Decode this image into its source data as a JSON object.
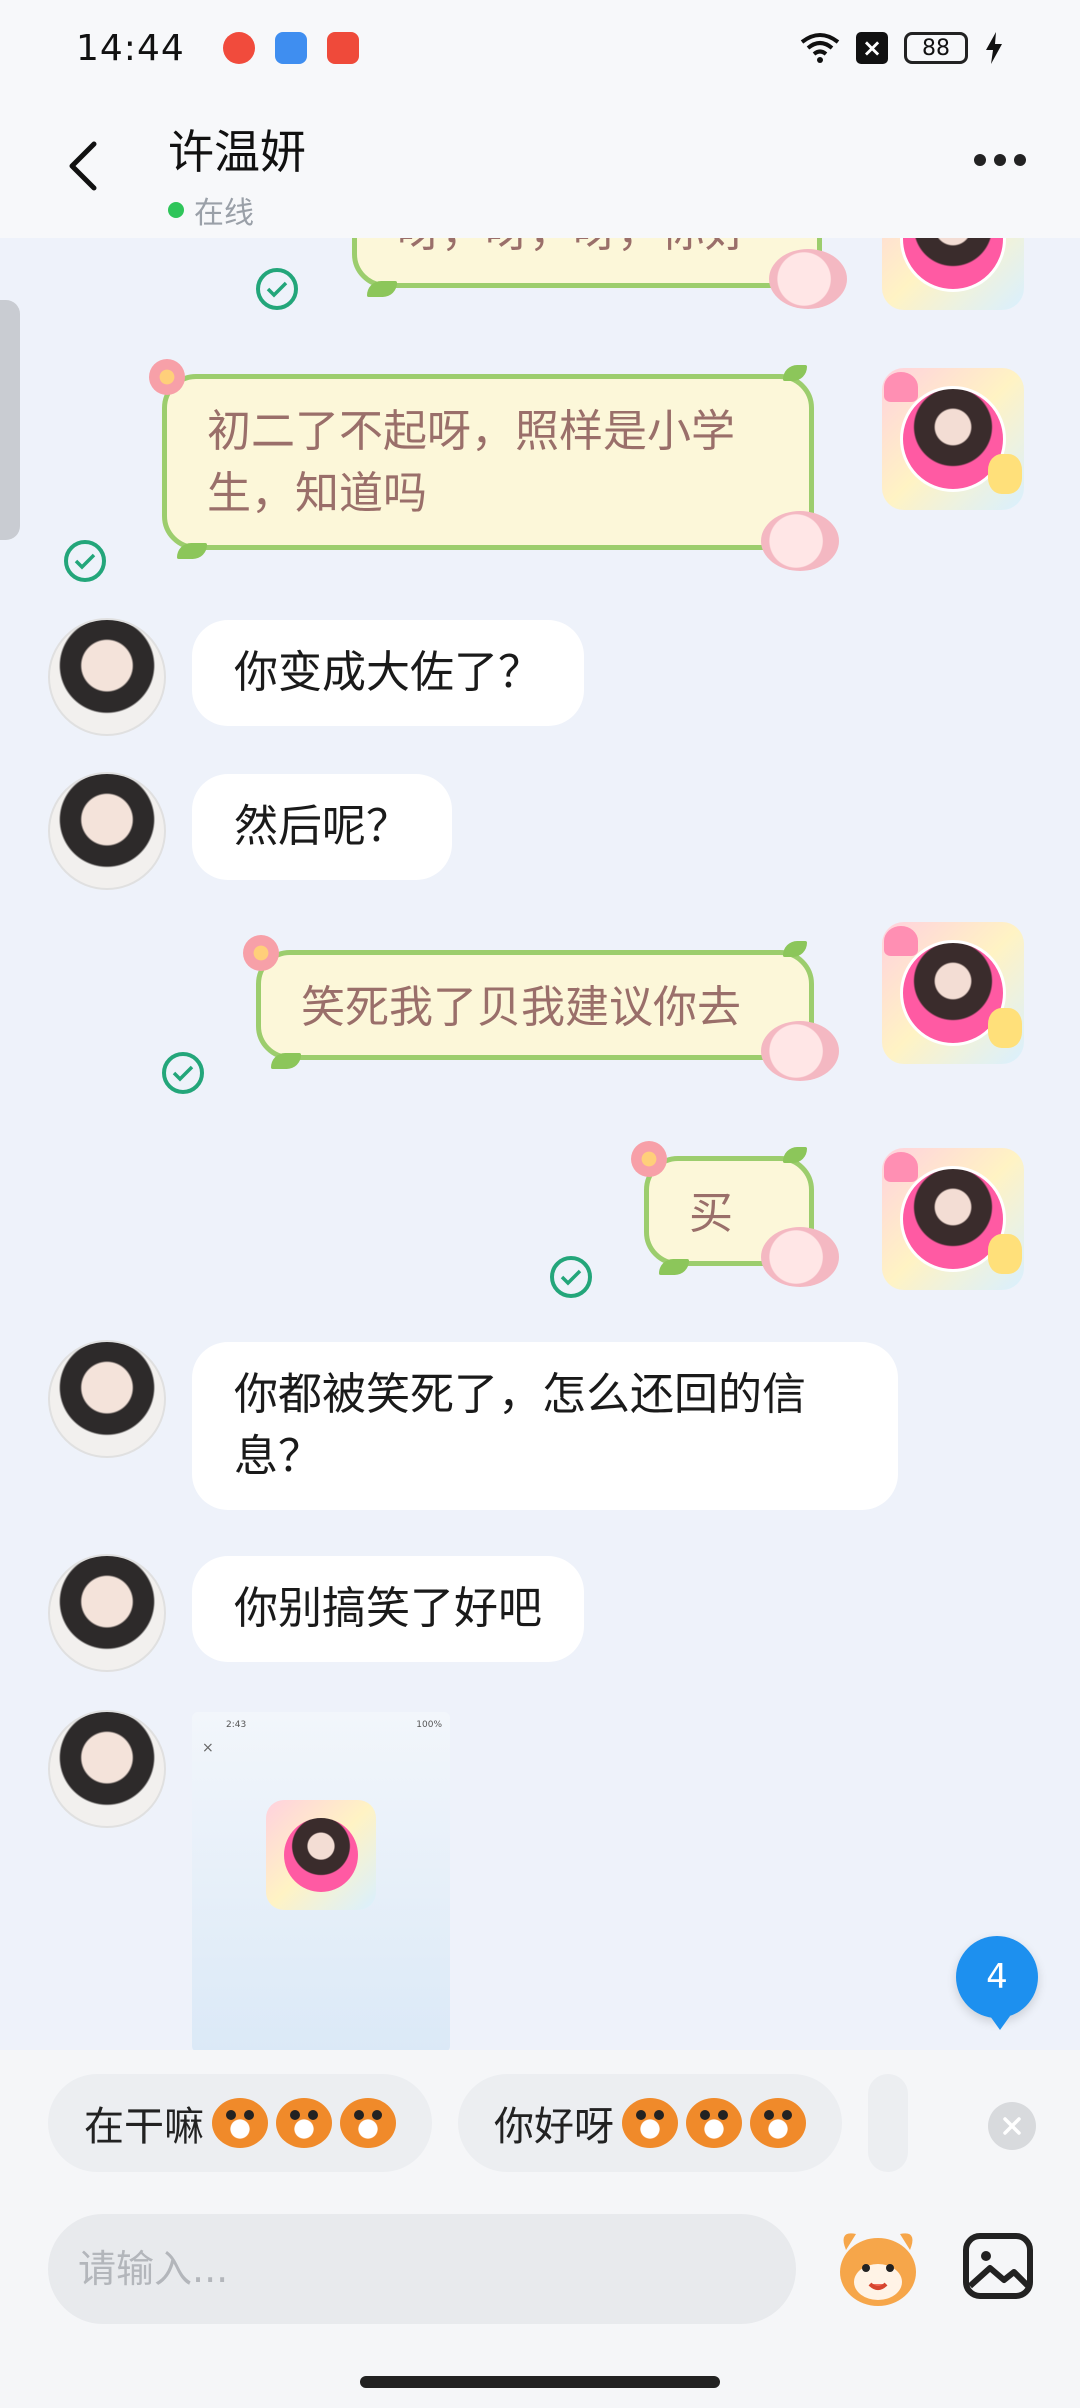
{
  "status_bar": {
    "time": "14:44",
    "battery": "88",
    "colors": {
      "app1": "#f14b3c",
      "app2": "#3f8ef0",
      "app3": "#ef4a3a"
    }
  },
  "header": {
    "title": "许温妍",
    "status": "在线",
    "icons": [
      "chevron-left-icon",
      "more-icon"
    ]
  },
  "messages": [
    {
      "side": "self",
      "text": "呀，呀，呀，你好",
      "partial": true
    },
    {
      "side": "self",
      "text": "初二了不起呀，照样是小学生，知道吗",
      "line1": "初二了不起呀，照样是小学",
      "line2": "生，知道吗"
    },
    {
      "side": "other",
      "text": "你变成大佐了？"
    },
    {
      "side": "other",
      "text": "然后呢？"
    },
    {
      "side": "self",
      "text": "笑死我了贝我建议你去"
    },
    {
      "side": "self",
      "text": "买"
    },
    {
      "side": "other",
      "text": "你都被笑死了，怎么还回的信息？",
      "line1": "你都被笑死了，怎么还回的信",
      "line2": "息？"
    },
    {
      "side": "other",
      "text": "你别搞笑了好吧"
    },
    {
      "side": "other",
      "type": "image"
    }
  ],
  "image_message": {
    "mini_time": "2:43",
    "mini_battery": "100%",
    "mini_close": "×"
  },
  "unread_count": "4",
  "quick_replies": [
    "在干嘛",
    "你好呀"
  ],
  "input": {
    "placeholder": "请输入..."
  },
  "accent_colors": {
    "bubble_self_border": "#9ccd6d",
    "bubble_self_bg": "#fcf7d9",
    "check": "#23a67a",
    "badge": "#1d90ef"
  }
}
